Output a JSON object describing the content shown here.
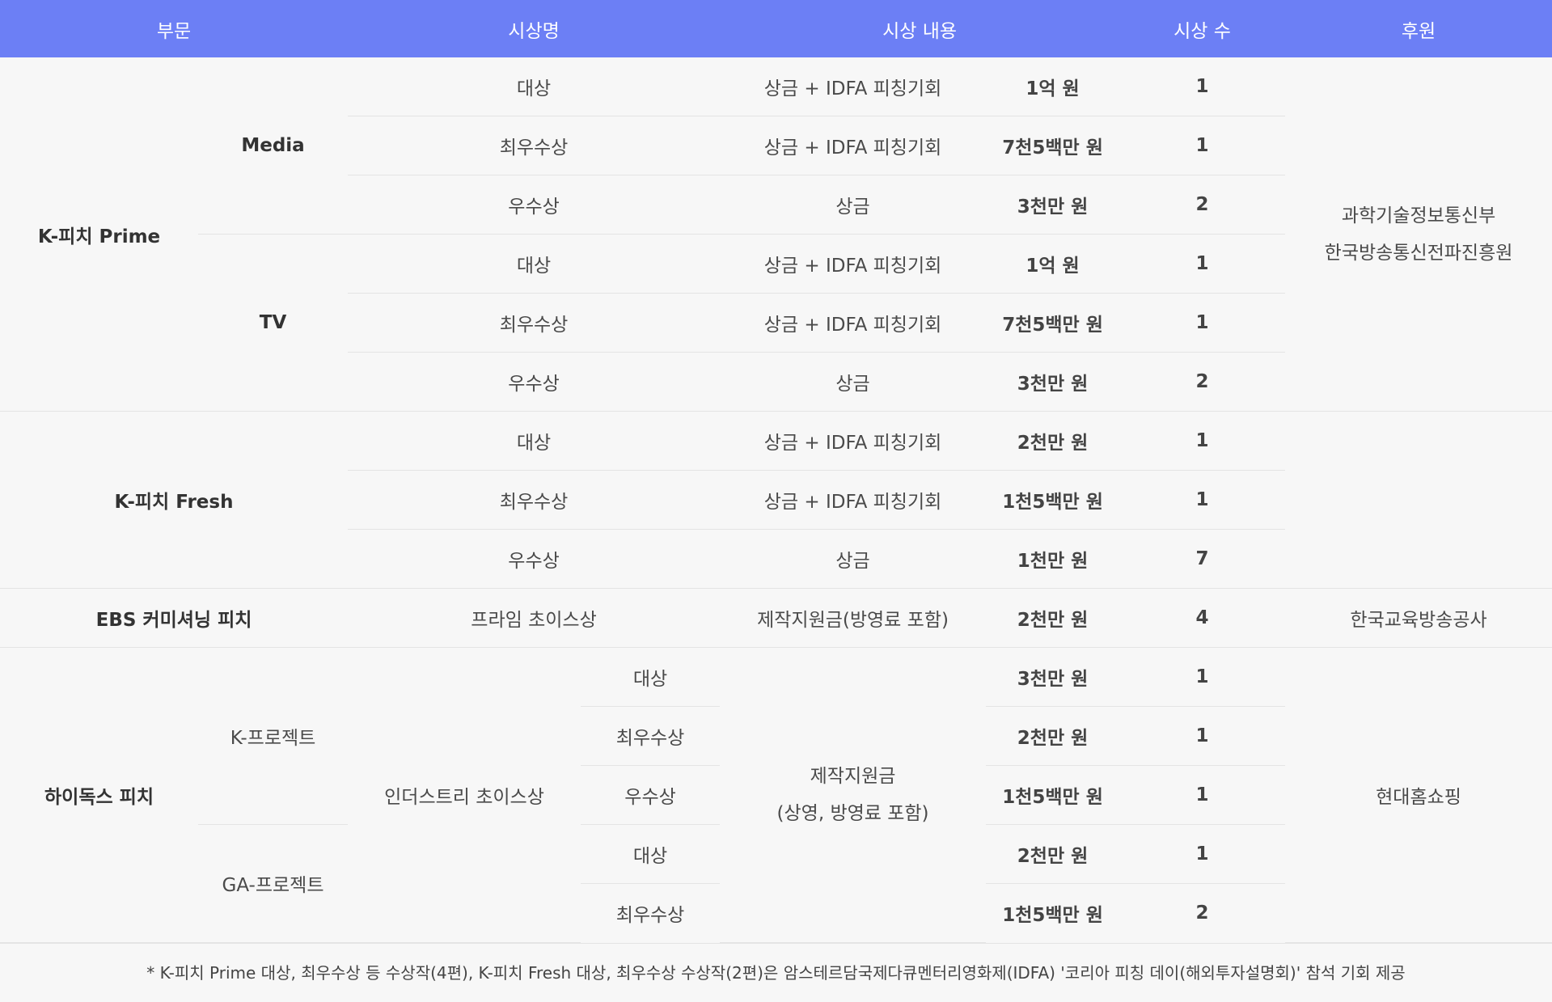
{
  "header": [
    "부문",
    "시상명",
    "시상 내용",
    "시상 수",
    "후원"
  ],
  "kpitch_prime": {
    "label": "K-피치 Prime",
    "media": {
      "label": "Media",
      "rows": [
        {
          "award": "대상",
          "content": "상금 + IDFA 피칭기회",
          "amount": "1억 원",
          "count": "1"
        },
        {
          "award": "최우수상",
          "content": "상금 + IDFA 피칭기회",
          "amount": "7천5백만 원",
          "count": "1"
        },
        {
          "award": "우수상",
          "content": "상금",
          "amount": "3천만 원",
          "count": "2"
        }
      ]
    },
    "tv": {
      "label": "TV",
      "rows": [
        {
          "award": "대상",
          "content": "상금 + IDFA 피칭기회",
          "amount": "1억 원",
          "count": "1"
        },
        {
          "award": "최우수상",
          "content": "상금 + IDFA 피칭기회",
          "amount": "7천5백만 원",
          "count": "1"
        },
        {
          "award": "우수상",
          "content": "상금",
          "amount": "3천만 원",
          "count": "2"
        }
      ]
    }
  },
  "sponsor_main": {
    "line1": "과학기술정보통신부",
    "line2": "한국방송통신전파진흥원"
  },
  "kpitch_fresh": {
    "label": "K-피치 Fresh",
    "rows": [
      {
        "award": "대상",
        "content": "상금 + IDFA 피칭기회",
        "amount": "2천만 원",
        "count": "1"
      },
      {
        "award": "최우수상",
        "content": "상금 + IDFA 피칭기회",
        "amount": "1천5백만 원",
        "count": "1"
      },
      {
        "award": "우수상",
        "content": "상금",
        "amount": "1천만 원",
        "count": "7"
      }
    ]
  },
  "ebs": {
    "label": "EBS 커미셔닝 피치",
    "award": "프라임 초이스상",
    "content": "제작지원금(방영료 포함)",
    "amount": "2천만 원",
    "count": "4",
    "sponsor": "한국교육방송공사"
  },
  "hidocs": {
    "label": "하이독스 피치",
    "award_group": "인더스트리 초이스상",
    "content_line1": "제작지원금",
    "content_line2": "(상영, 방영료 포함)",
    "sponsor": "현대홈쇼핑",
    "k_project": {
      "label": "K-프로젝트",
      "rows": [
        {
          "award": "대상",
          "amount": "3천만 원",
          "count": "1"
        },
        {
          "award": "최우수상",
          "amount": "2천만 원",
          "count": "1"
        },
        {
          "award": "우수상",
          "amount": "1천5백만 원",
          "count": "1"
        }
      ]
    },
    "ga_project": {
      "label": "GA-프로젝트",
      "rows": [
        {
          "award": "대상",
          "amount": "2천만 원",
          "count": "1"
        },
        {
          "award": "최우수상",
          "amount": "1천5백만 원",
          "count": "2"
        }
      ]
    }
  },
  "footnote": "* K-피치 Prime 대상, 최우수상 등 수상작(4편), K-피치 Fresh 대상, 최우수상 수상작(2편)은 암스테르담국제다큐멘터리영화제(IDFA) '코리아 피칭 데이(해외투자설명회)' 참석 기회 제공"
}
